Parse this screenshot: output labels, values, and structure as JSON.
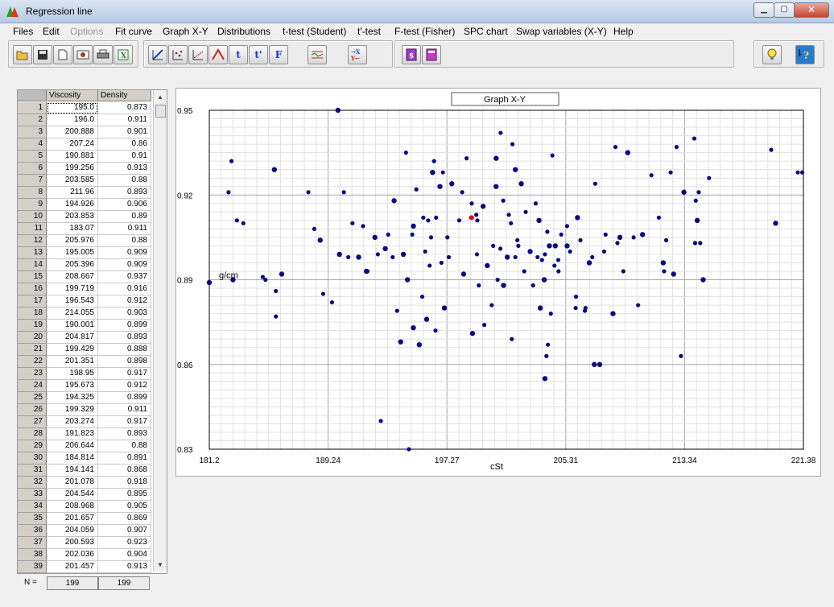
{
  "window": {
    "title": "Regression line",
    "min_glyph": "▁",
    "max_glyph": "▢",
    "close_glyph": "✕"
  },
  "menu": [
    "Files",
    "Edit",
    "Options",
    "Fit curve",
    "Graph X-Y",
    "Distributions",
    "t-test (Student)",
    "t'-test",
    "F-test (Fisher)",
    "SPC chart",
    "Swap variables (X-Y)",
    "Help"
  ],
  "menu_disabled": [
    "Options"
  ],
  "toolbar": {
    "group1": [
      "open-icon",
      "save-icon",
      "new-document-icon",
      "preview-icon",
      "print-icon",
      "export-icon"
    ],
    "group2": [
      "fit-curve-icon",
      "scatter-plot-icon",
      "regression-plot-icon",
      "distribution-icon",
      "t-test-icon",
      "t-prime-test-icon",
      "f-test-icon",
      "spc-chart-icon",
      "swap-variables-icon"
    ],
    "group2_labels": {
      "t-test-icon": "t",
      "t-prime-test-icon": "t'",
      "f-test-icon": "F"
    },
    "group3": [
      "calculator-icon",
      "calculator-2-icon"
    ],
    "group4": [
      "tip-icon",
      "help-icon"
    ]
  },
  "grid": {
    "headers": [
      "Viscosity",
      "Density"
    ],
    "rows": [
      [
        "1",
        "195.0",
        "0.873"
      ],
      [
        "2",
        "196.0",
        "0.911"
      ],
      [
        "3",
        "200.888",
        "0.901"
      ],
      [
        "4",
        "207.24",
        "0.86"
      ],
      [
        "5",
        "190.881",
        "0.91"
      ],
      [
        "6",
        "199.256",
        "0.913"
      ],
      [
        "7",
        "203.585",
        "0.88"
      ],
      [
        "8",
        "211.96",
        "0.893"
      ],
      [
        "9",
        "194.926",
        "0.906"
      ],
      [
        "10",
        "203.853",
        "0.89"
      ],
      [
        "11",
        "183.07",
        "0.911"
      ],
      [
        "12",
        "205.976",
        "0.88"
      ],
      [
        "13",
        "195.005",
        "0.909"
      ],
      [
        "14",
        "205.396",
        "0.909"
      ],
      [
        "15",
        "208.667",
        "0.937"
      ],
      [
        "16",
        "199.719",
        "0.916"
      ],
      [
        "17",
        "196.543",
        "0.912"
      ],
      [
        "18",
        "214.055",
        "0.903"
      ],
      [
        "19",
        "190.001",
        "0.899"
      ],
      [
        "20",
        "204.817",
        "0.893"
      ],
      [
        "21",
        "199.429",
        "0.888"
      ],
      [
        "22",
        "201.351",
        "0.898"
      ],
      [
        "23",
        "198.95",
        "0.917"
      ],
      [
        "24",
        "195.673",
        "0.912"
      ],
      [
        "25",
        "194.325",
        "0.899"
      ],
      [
        "26",
        "199.329",
        "0.911"
      ],
      [
        "27",
        "203.274",
        "0.917"
      ],
      [
        "28",
        "191.823",
        "0.893"
      ],
      [
        "29",
        "206.644",
        "0.88"
      ],
      [
        "30",
        "184.814",
        "0.891"
      ],
      [
        "31",
        "194.141",
        "0.868"
      ],
      [
        "32",
        "201.078",
        "0.918"
      ],
      [
        "33",
        "204.544",
        "0.895"
      ],
      [
        "34",
        "208.968",
        "0.905"
      ],
      [
        "35",
        "201.657",
        "0.869"
      ],
      [
        "36",
        "204.059",
        "0.907"
      ],
      [
        "37",
        "200.593",
        "0.923"
      ],
      [
        "38",
        "202.036",
        "0.904"
      ],
      [
        "39",
        "201.457",
        "0.913"
      ]
    ],
    "n_label": "N =",
    "n_values": [
      "199",
      "199"
    ]
  },
  "chart_data": {
    "type": "scatter",
    "title": "Graph X-Y",
    "xlabel": "cSt",
    "ylabel": "g/cm",
    "xlim": [
      181.2,
      221.38
    ],
    "ylim": [
      0.83,
      0.95
    ],
    "x_ticks": [
      "181.2",
      "189.24",
      "197.27",
      "205.31",
      "213.34",
      "221.38"
    ],
    "y_ticks": [
      "0.95",
      "0.92",
      "0.89",
      "0.86",
      "0.83"
    ],
    "grid": true,
    "marker_color": "#0a0a80",
    "highlight_color": "#e01010",
    "highlight_point": [
      198.95,
      0.912
    ],
    "points": [
      [
        195.0,
        0.873
      ],
      [
        196.0,
        0.911
      ],
      [
        200.888,
        0.901
      ],
      [
        207.24,
        0.86
      ],
      [
        190.881,
        0.91
      ],
      [
        199.256,
        0.913
      ],
      [
        203.585,
        0.88
      ],
      [
        211.96,
        0.893
      ],
      [
        194.926,
        0.906
      ],
      [
        203.853,
        0.89
      ],
      [
        183.07,
        0.911
      ],
      [
        205.976,
        0.88
      ],
      [
        195.005,
        0.909
      ],
      [
        205.396,
        0.909
      ],
      [
        208.667,
        0.937
      ],
      [
        199.719,
        0.916
      ],
      [
        196.543,
        0.912
      ],
      [
        214.055,
        0.903
      ],
      [
        190.001,
        0.899
      ],
      [
        204.817,
        0.893
      ],
      [
        199.429,
        0.888
      ],
      [
        201.351,
        0.898
      ],
      [
        198.95,
        0.917
      ],
      [
        195.673,
        0.912
      ],
      [
        194.325,
        0.899
      ],
      [
        199.329,
        0.911
      ],
      [
        203.274,
        0.917
      ],
      [
        191.823,
        0.893
      ],
      [
        206.644,
        0.88
      ],
      [
        184.814,
        0.891
      ],
      [
        194.141,
        0.868
      ],
      [
        201.078,
        0.918
      ],
      [
        204.544,
        0.895
      ],
      [
        208.968,
        0.905
      ],
      [
        201.657,
        0.869
      ],
      [
        204.059,
        0.907
      ],
      [
        200.593,
        0.923
      ],
      [
        202.036,
        0.904
      ],
      [
        201.457,
        0.913
      ],
      [
        181.2,
        0.889
      ],
      [
        182.5,
        0.921
      ],
      [
        182.7,
        0.932
      ],
      [
        182.8,
        0.89
      ],
      [
        183.5,
        0.91
      ],
      [
        185.0,
        0.89
      ],
      [
        185.6,
        0.929
      ],
      [
        185.7,
        0.886
      ],
      [
        185.7,
        0.877
      ],
      [
        186.1,
        0.892
      ],
      [
        187.9,
        0.921
      ],
      [
        188.3,
        0.908
      ],
      [
        188.7,
        0.904
      ],
      [
        188.9,
        0.885
      ],
      [
        189.5,
        0.882
      ],
      [
        189.9,
        0.95
      ],
      [
        190.3,
        0.921
      ],
      [
        190.6,
        0.898
      ],
      [
        191.3,
        0.898
      ],
      [
        191.6,
        0.909
      ],
      [
        191.9,
        0.893
      ],
      [
        192.4,
        0.905
      ],
      [
        192.6,
        0.899
      ],
      [
        192.8,
        0.84
      ],
      [
        193.1,
        0.901
      ],
      [
        193.3,
        0.906
      ],
      [
        193.6,
        0.898
      ],
      [
        193.7,
        0.918
      ],
      [
        193.9,
        0.879
      ],
      [
        194.5,
        0.935
      ],
      [
        194.6,
        0.89
      ],
      [
        194.7,
        0.83
      ],
      [
        195.2,
        0.922
      ],
      [
        195.4,
        0.867
      ],
      [
        195.6,
        0.884
      ],
      [
        195.8,
        0.9
      ],
      [
        195.9,
        0.876
      ],
      [
        196.1,
        0.895
      ],
      [
        196.2,
        0.905
      ],
      [
        196.3,
        0.928
      ],
      [
        196.4,
        0.932
      ],
      [
        196.5,
        0.872
      ],
      [
        196.8,
        0.923
      ],
      [
        196.9,
        0.896
      ],
      [
        197.0,
        0.928
      ],
      [
        197.1,
        0.88
      ],
      [
        197.3,
        0.905
      ],
      [
        197.4,
        0.898
      ],
      [
        197.6,
        0.924
      ],
      [
        198.1,
        0.911
      ],
      [
        198.3,
        0.921
      ],
      [
        198.4,
        0.892
      ],
      [
        198.6,
        0.933
      ],
      [
        198.9,
        0.912
      ],
      [
        199.0,
        0.871
      ],
      [
        199.3,
        0.899
      ],
      [
        199.8,
        0.874
      ],
      [
        200.0,
        0.895
      ],
      [
        200.3,
        0.881
      ],
      [
        200.4,
        0.902
      ],
      [
        200.6,
        0.933
      ],
      [
        200.7,
        0.89
      ],
      [
        200.9,
        0.942
      ],
      [
        201.1,
        0.888
      ],
      [
        201.6,
        0.91
      ],
      [
        201.7,
        0.938
      ],
      [
        201.9,
        0.929
      ],
      [
        201.9,
        0.898
      ],
      [
        202.1,
        0.902
      ],
      [
        202.3,
        0.924
      ],
      [
        202.5,
        0.893
      ],
      [
        202.6,
        0.914
      ],
      [
        202.9,
        0.9
      ],
      [
        203.1,
        0.888
      ],
      [
        203.4,
        0.898
      ],
      [
        203.5,
        0.911
      ],
      [
        203.7,
        0.897
      ],
      [
        203.9,
        0.899
      ],
      [
        203.9,
        0.855
      ],
      [
        204.0,
        0.863
      ],
      [
        204.1,
        0.867
      ],
      [
        204.2,
        0.902
      ],
      [
        204.3,
        0.878
      ],
      [
        204.4,
        0.934
      ],
      [
        204.6,
        0.902
      ],
      [
        204.8,
        0.897
      ],
      [
        205.0,
        0.906
      ],
      [
        205.4,
        0.902
      ],
      [
        205.6,
        0.9
      ],
      [
        206.0,
        0.884
      ],
      [
        206.1,
        0.912
      ],
      [
        206.3,
        0.904
      ],
      [
        206.6,
        0.879
      ],
      [
        206.9,
        0.896
      ],
      [
        207.1,
        0.898
      ],
      [
        207.3,
        0.924
      ],
      [
        207.6,
        0.86
      ],
      [
        207.9,
        0.9
      ],
      [
        208.0,
        0.906
      ],
      [
        208.5,
        0.878
      ],
      [
        208.8,
        0.903
      ],
      [
        209.2,
        0.893
      ],
      [
        209.5,
        0.935
      ],
      [
        209.9,
        0.905
      ],
      [
        210.2,
        0.881
      ],
      [
        210.5,
        0.906
      ],
      [
        211.1,
        0.927
      ],
      [
        211.6,
        0.912
      ],
      [
        211.9,
        0.896
      ],
      [
        212.1,
        0.904
      ],
      [
        212.4,
        0.928
      ],
      [
        212.6,
        0.892
      ],
      [
        212.8,
        0.937
      ],
      [
        213.1,
        0.863
      ],
      [
        213.3,
        0.921
      ],
      [
        214.0,
        0.94
      ],
      [
        214.1,
        0.918
      ],
      [
        214.2,
        0.911
      ],
      [
        214.3,
        0.921
      ],
      [
        214.4,
        0.903
      ],
      [
        214.6,
        0.89
      ],
      [
        215.0,
        0.926
      ],
      [
        219.2,
        0.936
      ],
      [
        219.5,
        0.91
      ],
      [
        221.0,
        0.928
      ],
      [
        221.3,
        0.928
      ]
    ]
  }
}
